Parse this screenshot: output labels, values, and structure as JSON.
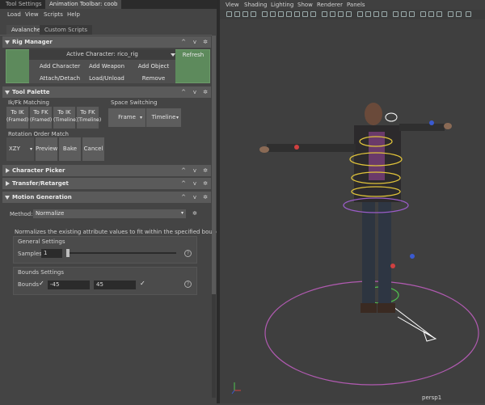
{
  "tabs": [
    {
      "label": "Tool Settings",
      "active": false
    },
    {
      "label": "Animation Toolbar: coob",
      "active": true
    }
  ],
  "menu": [
    "Load",
    "View",
    "Scripts",
    "Help"
  ],
  "subtabs": [
    {
      "label": "Avalanche",
      "active": true
    },
    {
      "label": "Custom Scripts",
      "active": false
    }
  ],
  "rig_manager": {
    "title": "Rig Manager",
    "active_character": "Active Character: rico_rig",
    "refresh": "Refresh",
    "add_character": "Add Character",
    "add_weapon": "Add Weapon",
    "add_object": "Add Object",
    "attach_detach": "Attach/Detach",
    "load_unload": "Load/Unload",
    "remove": "Remove"
  },
  "tool_palette": {
    "title": "Tool Palette",
    "ikfk_label": "Ik/Fk Matching",
    "space_label": "Space Switching",
    "buttons": [
      {
        "top": "To IK",
        "bottom": "(Framed)"
      },
      {
        "top": "To FK",
        "bottom": "(Framed)"
      },
      {
        "top": "To IK",
        "bottom": "(Timeline)"
      },
      {
        "top": "To FK",
        "bottom": "(Timeline)"
      }
    ],
    "frame": "Frame",
    "timeline": "Timeline",
    "rotation_label": "Rotation Order Match",
    "rotation_value": "XZY",
    "preview": "Preview",
    "bake": "Bake",
    "cancel": "Cancel"
  },
  "character_picker": {
    "title": "Character Picker"
  },
  "transfer_retarget": {
    "title": "Transfer/Retarget"
  },
  "motion_generation": {
    "title": "Motion Generation",
    "method_label": "Method:",
    "method_value": "Normalize",
    "description": "Normalizes the existing attribute values to fit within the specified bounds.",
    "general_settings": "General Settings",
    "samples_label": "Samples",
    "samples_value": "1",
    "bounds_settings": "Bounds Settings",
    "bounds_label": "Bounds",
    "bound_min": "-45",
    "bound_max": "45"
  },
  "viewport": {
    "menu": [
      "View",
      "Shading",
      "Lighting",
      "Show",
      "Renderer",
      "Panels"
    ],
    "camera_label": "persp1"
  },
  "icons": [
    "settings-gear-icon",
    "chevron-up-icon",
    "chevron-down-icon",
    "help-icon",
    "checkmark-icon"
  ]
}
